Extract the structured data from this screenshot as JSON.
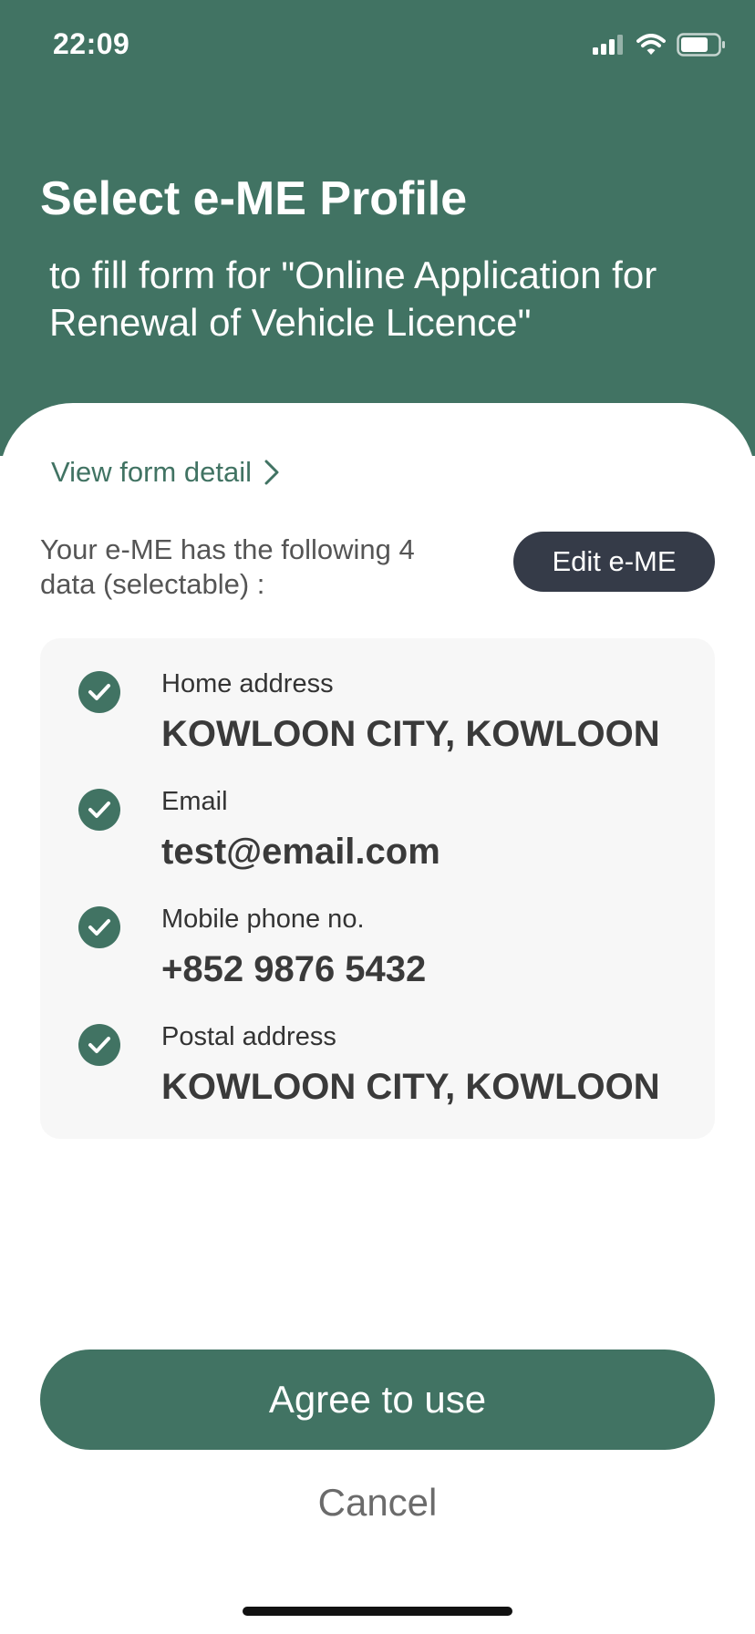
{
  "status_bar": {
    "time": "22:09",
    "icons": [
      "cellular-signal-icon",
      "wifi-icon",
      "battery-icon"
    ]
  },
  "header": {
    "title": "Select e-ME Profile",
    "subtitle": "to fill form for \"Online Application for Renewal of Vehicle Licence\""
  },
  "view_detail": {
    "label": "View form detail",
    "icon": "chevron-right-icon"
  },
  "intro_text": "Your e-ME has the following 4 data (selectable) :",
  "edit_button": "Edit e-ME",
  "items": [
    {
      "label": "Home address",
      "value": "KOWLOON CITY, KOWLOON",
      "checked": true
    },
    {
      "label": "Email",
      "value": "test@email.com",
      "checked": true
    },
    {
      "label": "Mobile phone no.",
      "value": "+852 9876 5432",
      "checked": true
    },
    {
      "label": "Postal address",
      "value": "KOWLOON CITY, KOWLOON",
      "checked": true
    }
  ],
  "agree_button": "Agree to use",
  "cancel_button": "Cancel",
  "colors": {
    "brand_green": "#417363",
    "edit_button_bg": "#353b48",
    "card_bg": "#f7f7f7"
  }
}
